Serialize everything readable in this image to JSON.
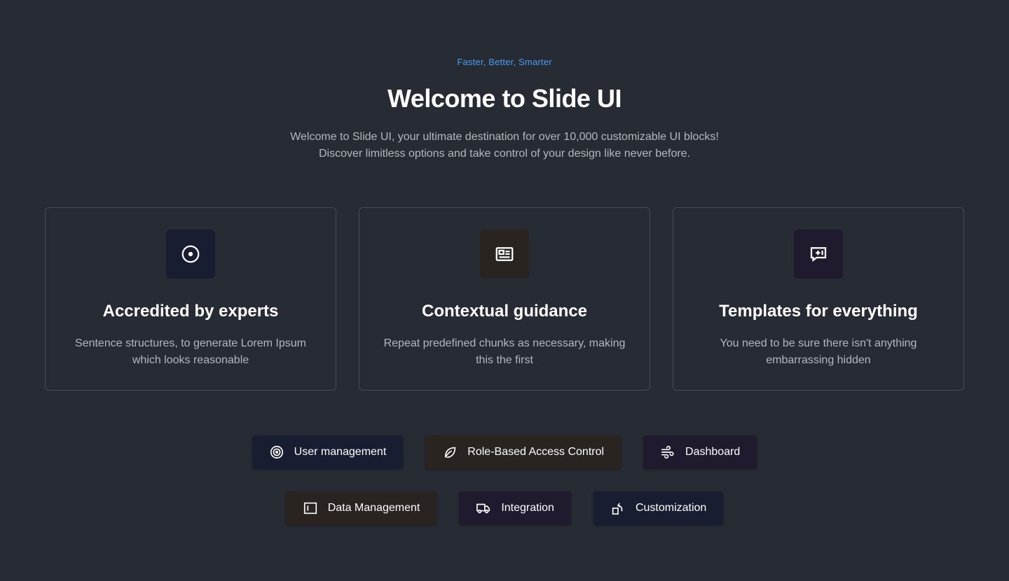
{
  "hero": {
    "eyebrow": "Faster, Better, Smarter",
    "title": "Welcome to Slide UI",
    "subtitle": "Welcome to Slide UI, your ultimate destination for over 10,000 customizable UI blocks! Discover limitless options and take control of your design like never before."
  },
  "cards": [
    {
      "icon": "target-icon",
      "title": "Accredited by experts",
      "desc": "Sentence structures, to generate Lorem Ipsum which looks reasonable",
      "icon_bg": "#181d31"
    },
    {
      "icon": "news-icon",
      "title": "Contextual guidance",
      "desc": "Repeat predefined chunks as necessary, making this the first",
      "icon_bg": "#2a2420"
    },
    {
      "icon": "message-plus-icon",
      "title": "Templates for everything",
      "desc": "You need to be sure there isn't anything embarrassing hidden",
      "icon_bg": "#1f1a2e"
    }
  ],
  "features": [
    {
      "label": "User management",
      "icon": "target-icon"
    },
    {
      "label": "Role-Based Access Control",
      "icon": "leaf-icon"
    },
    {
      "label": "Dashboard",
      "icon": "wind-icon"
    },
    {
      "label": "Data Management",
      "icon": "layout-sidebar-icon"
    },
    {
      "label": "Integration",
      "icon": "truck-icon"
    },
    {
      "label": "Customization",
      "icon": "transform-icon"
    }
  ],
  "colors": {
    "background": "#272b33",
    "accent": "#4a9df3",
    "card_border": "#464a52",
    "muted_text": "#b3b7be"
  }
}
